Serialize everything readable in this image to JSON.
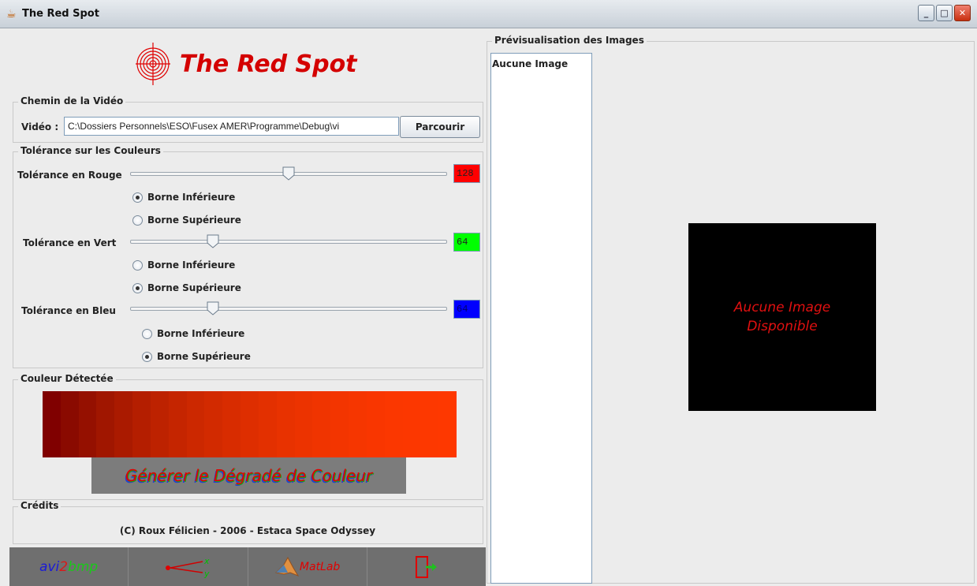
{
  "window": {
    "title": "The Red Spot",
    "controls": {
      "minimize": "_",
      "maximize": "□",
      "close": "✕"
    }
  },
  "logo": {
    "text": "The Red Spot",
    "icon": "target-icon"
  },
  "video_path": {
    "group_title": "Chemin de la Vidéo",
    "label": "Vidéo :",
    "value": "C:\\Dossiers Personnels\\ESO\\Fusex AMER\\Programme\\Debug\\vi",
    "browse_button": "Parcourir"
  },
  "tolerance": {
    "group_title": "Tolérance sur les Couleurs",
    "red": {
      "label": "Tolérance en Rouge",
      "value": "128",
      "color": "#ff0000",
      "slider_fraction": 0.5,
      "radios": [
        {
          "label": "Borne Inférieure",
          "selected": true
        },
        {
          "label": "Borne Supérieure",
          "selected": false
        }
      ]
    },
    "green": {
      "label": "Tolérance en Vert",
      "value": "64",
      "color": "#00ff00",
      "slider_fraction": 0.25,
      "radios": [
        {
          "label": "Borne Inférieure",
          "selected": false
        },
        {
          "label": "Borne Supérieure",
          "selected": true
        }
      ]
    },
    "blue": {
      "label": "Tolérance en Bleu",
      "value": "64",
      "color": "#0000ff",
      "slider_fraction": 0.25,
      "radios": [
        {
          "label": "Borne Inférieure",
          "selected": false
        },
        {
          "label": "Borne Supérieure",
          "selected": true
        }
      ]
    }
  },
  "detected_color": {
    "group_title": "Couleur Détectée",
    "gradient_colors": [
      "#800000",
      "#8a0a00",
      "#951000",
      "#a01600",
      "#aa1a00",
      "#b41e00",
      "#bd2200",
      "#c52500",
      "#cc2800",
      "#d22a00",
      "#d82c00",
      "#de2e00",
      "#e33000",
      "#e83200",
      "#ec3300",
      "#f03400",
      "#f33500",
      "#f63600",
      "#f93600",
      "#fb3700",
      "#fc3700",
      "#fd3800",
      "#fe3800"
    ],
    "generate_button": "Générer le Dégradé de Couleur"
  },
  "credits": {
    "group_title": "Crédits",
    "text": "(C) Roux Félicien - 2006 - Estaca Space Odyssey"
  },
  "toolbar": {
    "avi2bmp": {
      "part1": "avi",
      "part2": "2",
      "part3": "bmp"
    },
    "axes_tool": {
      "x": "x",
      "y": "y"
    },
    "matlab": "MatLab",
    "exit_icon": "exit-icon"
  },
  "preview": {
    "group_title": "Prévisualisation des Images",
    "list_item": "Aucune Image",
    "placeholder_line1": "Aucune Image",
    "placeholder_line2": "Disponible"
  }
}
